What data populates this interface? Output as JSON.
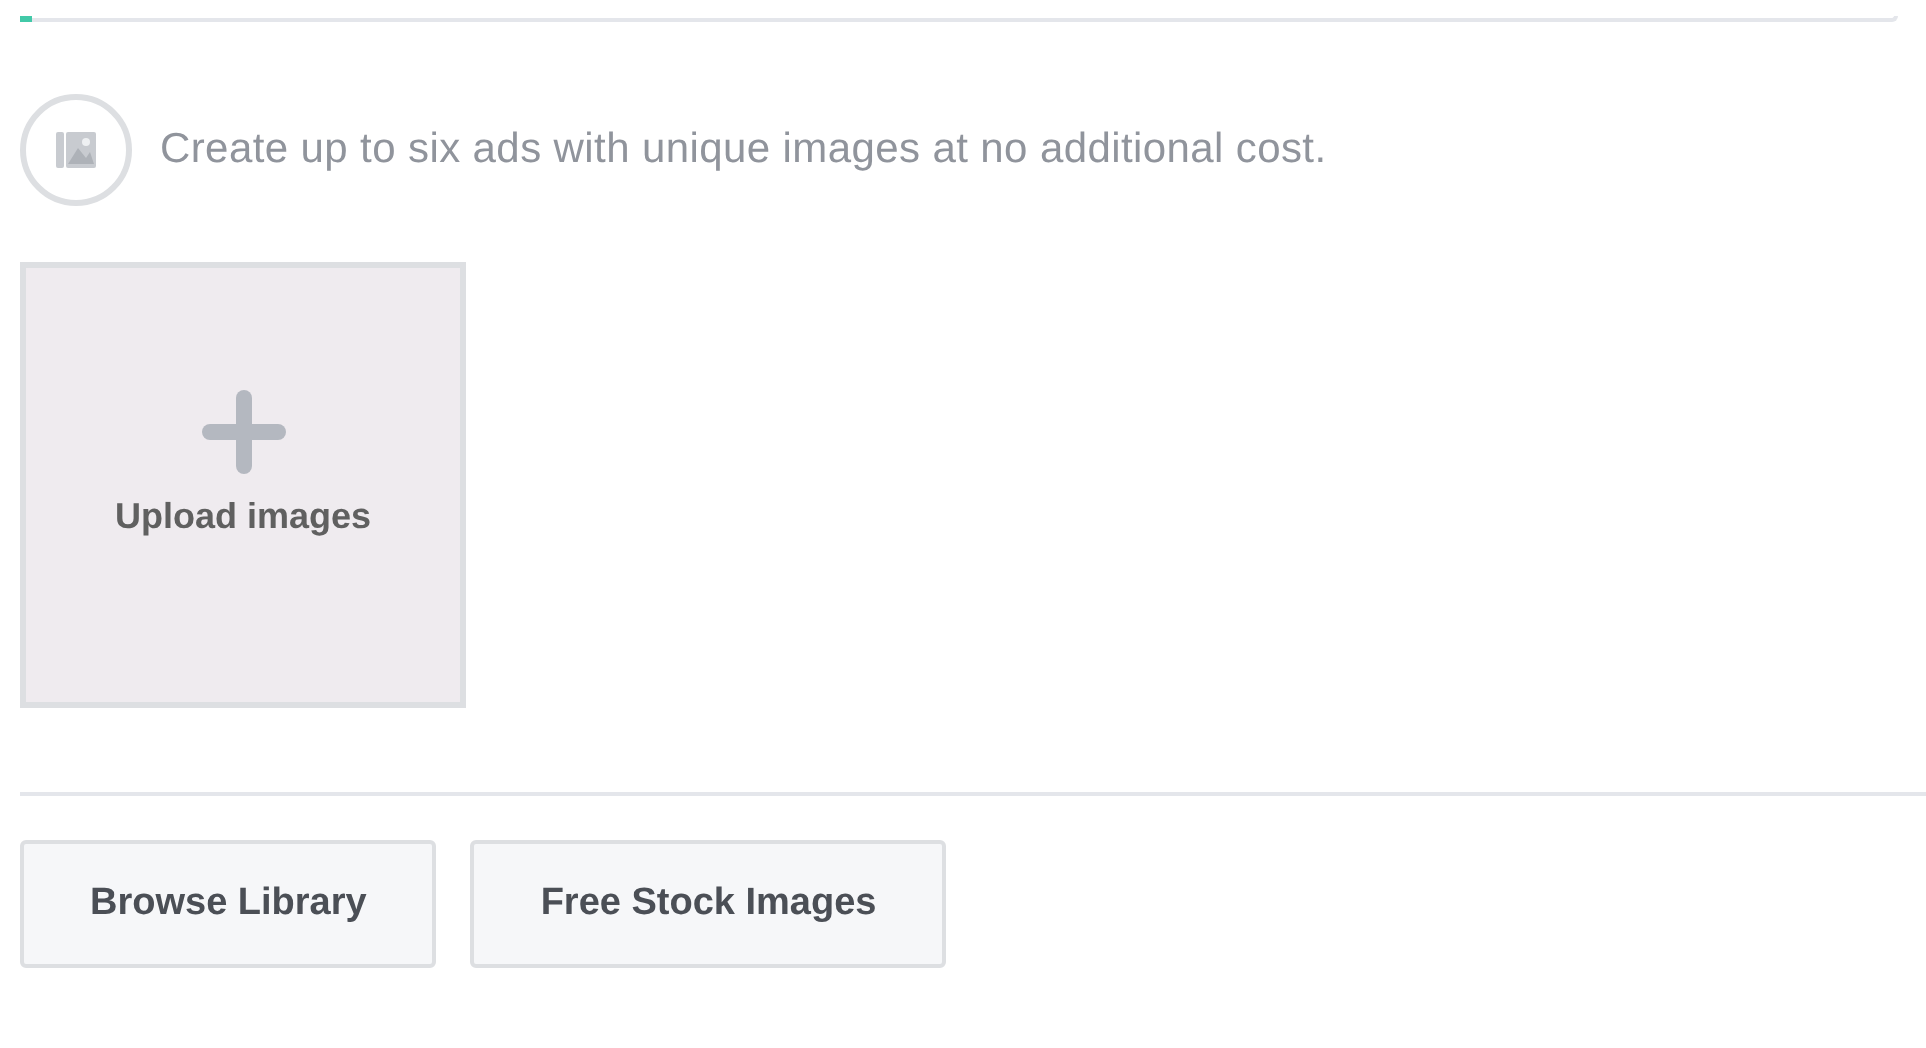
{
  "progress": {
    "level": 0.006
  },
  "info": {
    "text": "Create up to six ads with unique images at no additional cost."
  },
  "upload_tile": {
    "label": "Upload images"
  },
  "buttons": [
    "Browse Library",
    "Free Stock Images"
  ]
}
